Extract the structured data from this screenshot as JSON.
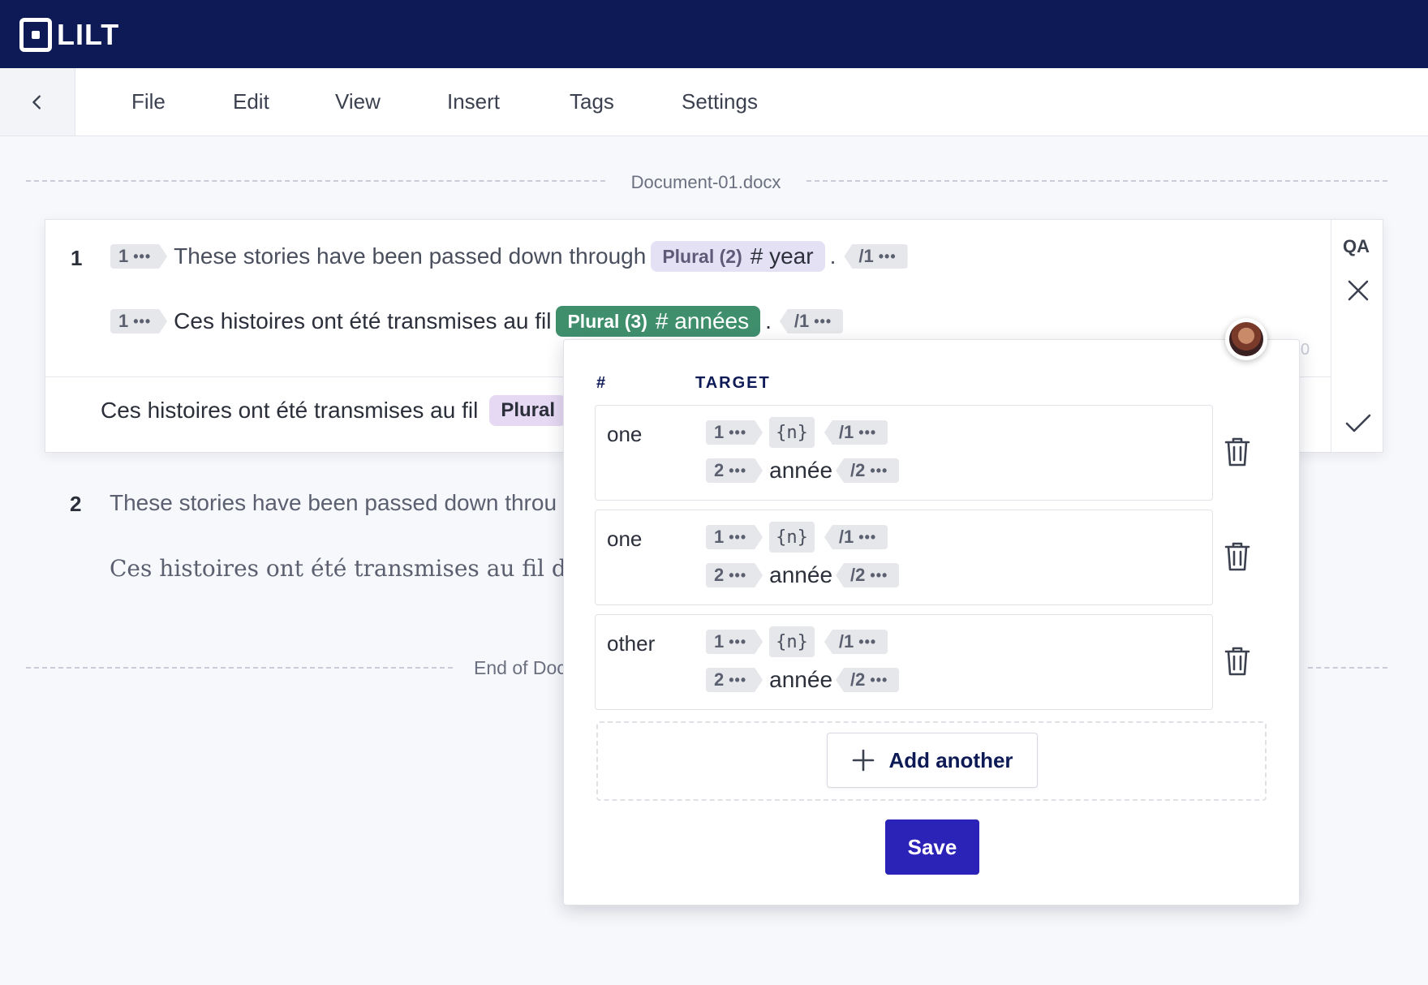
{
  "app": {
    "brand": "LILT"
  },
  "menu": {
    "items": [
      "File",
      "Edit",
      "View",
      "Insert",
      "Tags",
      "Settings"
    ]
  },
  "document": {
    "title": "Document-01.docx",
    "end_label": "End of Doc"
  },
  "segments": [
    {
      "number": "1",
      "source": {
        "tag_open": "1",
        "text": "These stories have been passed down through",
        "plural_label": "Plural (2)",
        "plural_text": "# year",
        "punct": ".",
        "tag_close": "/1"
      },
      "target": {
        "tag_open": "1",
        "text": "Ces histoires ont été transmises au fil",
        "plural_label": "Plural (3)",
        "plural_text": "# années",
        "punct": ".",
        "tag_close": "/1"
      },
      "suggestion": {
        "text": "Ces histoires ont été transmises au fil",
        "plural_label": "Plural"
      },
      "side": {
        "qa_label": "QA"
      },
      "counter": "0"
    },
    {
      "number": "2",
      "source": "These stories have been passed down throu",
      "target": "Ces histoires ont été transmises au fil des ar"
    }
  ],
  "popup": {
    "col_hash": "#",
    "col_target": "TARGET",
    "rows": [
      {
        "category": "one",
        "tag1_open": "1",
        "n": "{n}",
        "tag1_close": "/1",
        "tag2_open": "2",
        "word": "année",
        "tag2_close": "/2"
      },
      {
        "category": "one",
        "tag1_open": "1",
        "n": "{n}",
        "tag1_close": "/1",
        "tag2_open": "2",
        "word": "année",
        "tag2_close": "/2"
      },
      {
        "category": "other",
        "tag1_open": "1",
        "n": "{n}",
        "tag1_close": "/1",
        "tag2_open": "2",
        "word": "année",
        "tag2_close": "/2"
      }
    ],
    "add_label": "Add another",
    "save_label": "Save"
  },
  "colors": {
    "header": "#0d1a56",
    "save": "#2b22b8",
    "plural_green": "#3f8f6d",
    "plural_lavender": "#e4e1f4"
  },
  "icons": [
    "back-chevron-icon",
    "close-icon",
    "check-icon",
    "trash-icon",
    "plus-icon"
  ]
}
